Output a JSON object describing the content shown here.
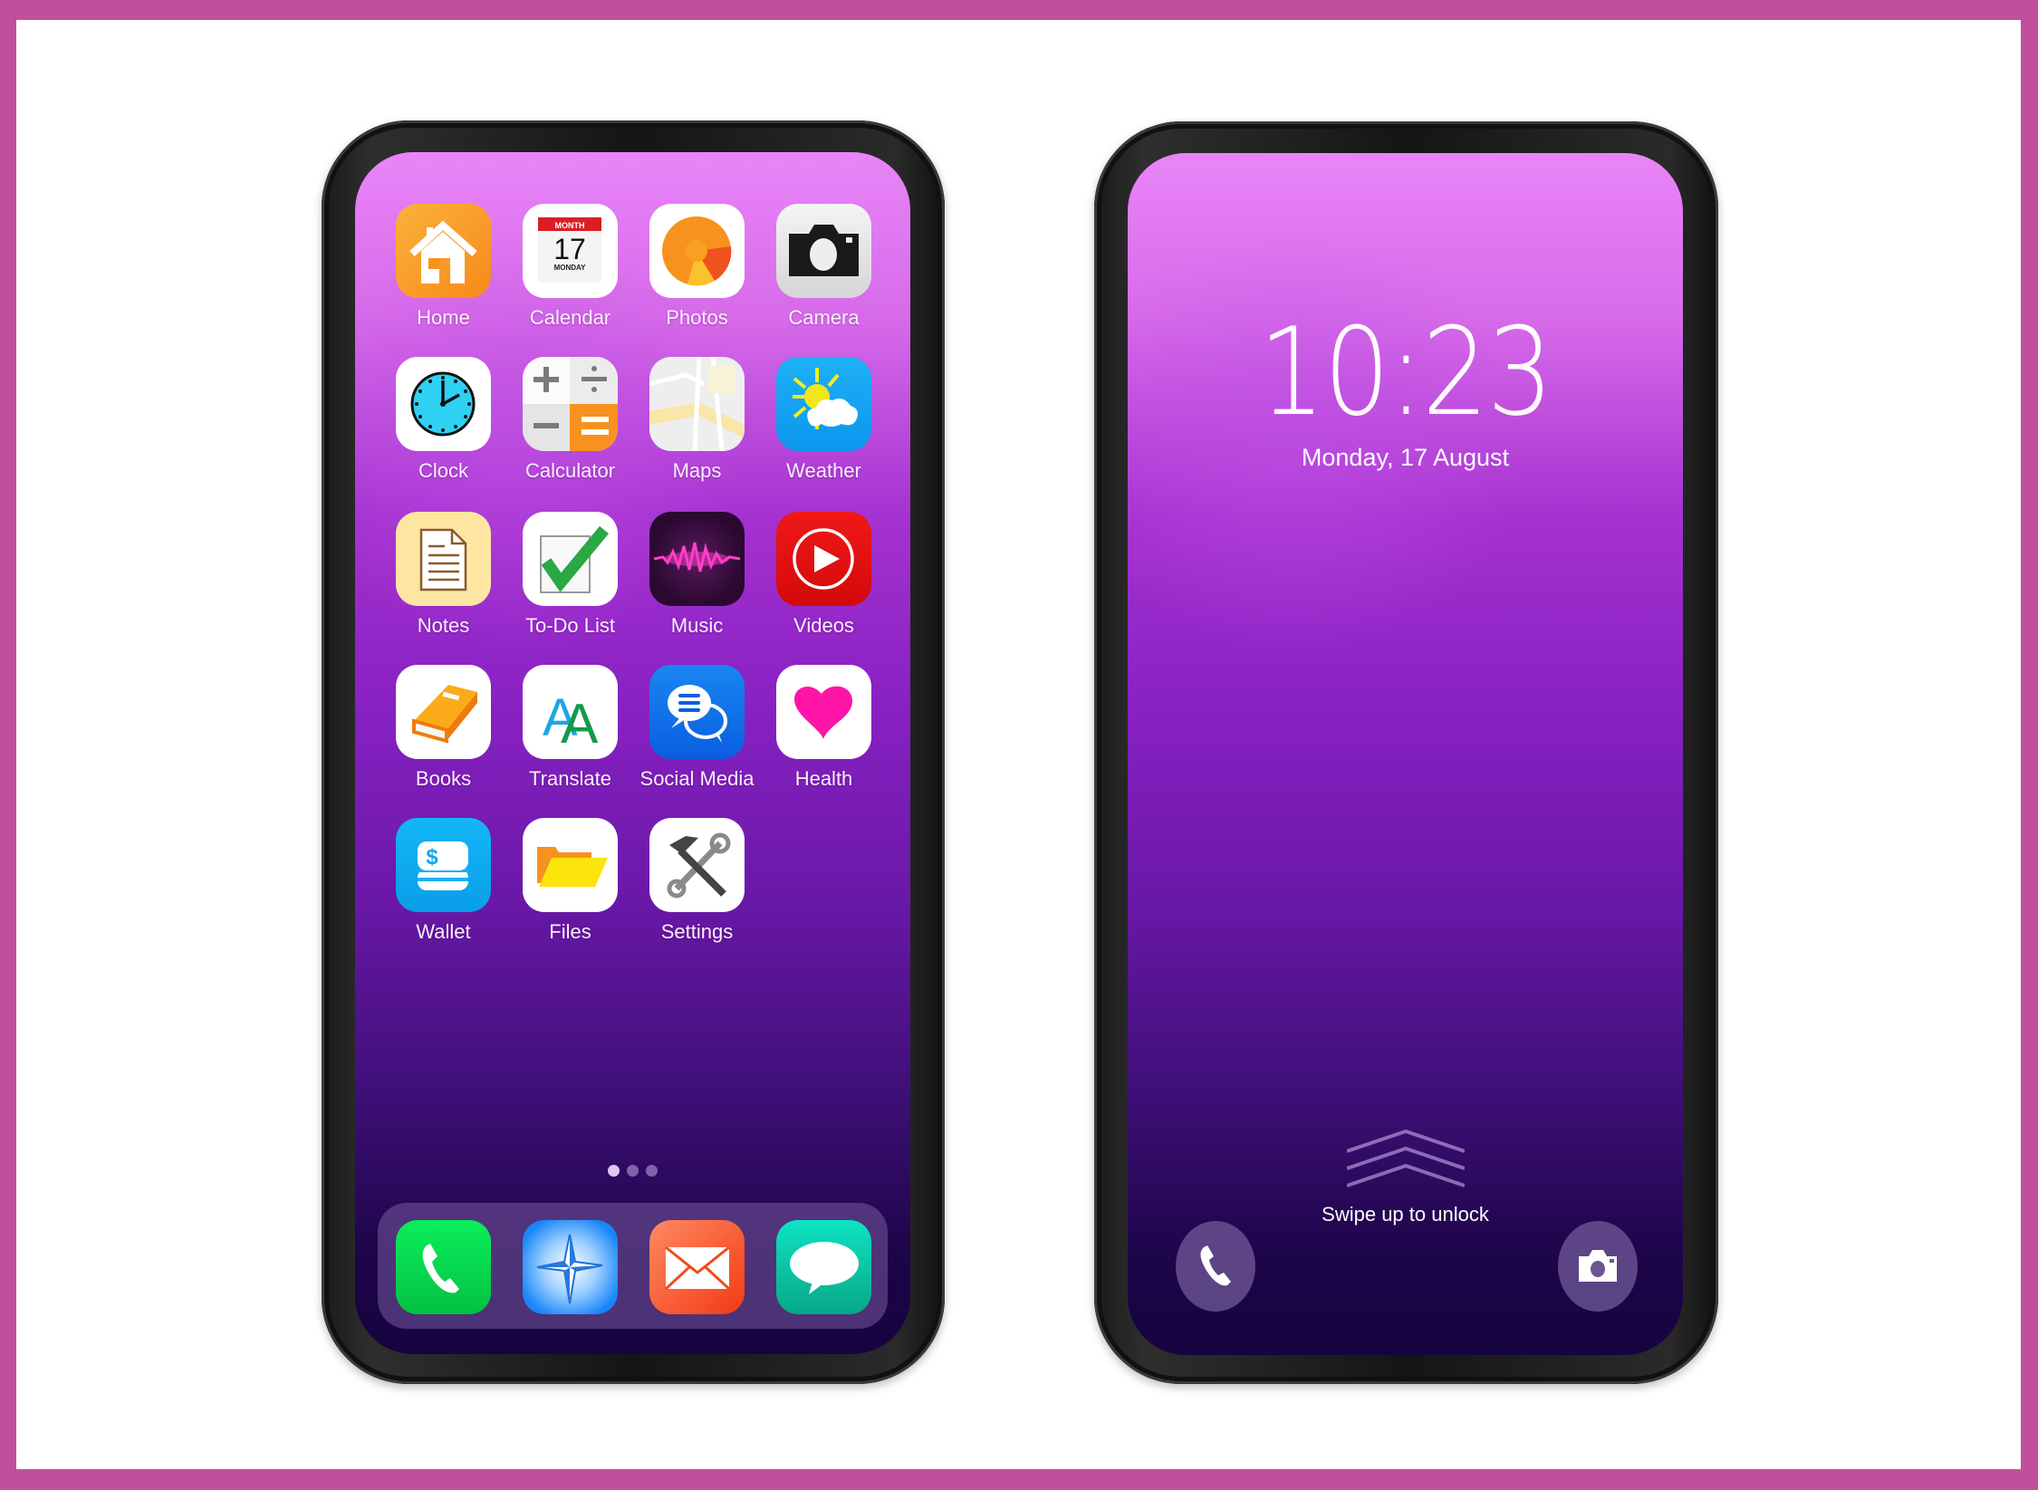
{
  "frame_color": "#c24f9c",
  "home_screen": {
    "apps": [
      {
        "label": "Home",
        "icon": "house-icon",
        "color": "#f7941d"
      },
      {
        "label": "Calendar",
        "icon": "calendar-icon",
        "month": "MONTH",
        "day": "17",
        "weekday": "MONDAY"
      },
      {
        "label": "Photos",
        "icon": "flower-icon"
      },
      {
        "label": "Camera",
        "icon": "camera-icon"
      },
      {
        "label": "Clock",
        "icon": "clock-icon"
      },
      {
        "label": "Calculator",
        "icon": "calculator-icon"
      },
      {
        "label": "Maps",
        "icon": "map-icon"
      },
      {
        "label": "Weather",
        "icon": "weather-icon"
      },
      {
        "label": "Notes",
        "icon": "notes-icon"
      },
      {
        "label": "To-Do List",
        "icon": "checkmark-icon"
      },
      {
        "label": "Music",
        "icon": "waveform-icon"
      },
      {
        "label": "Videos",
        "icon": "play-icon"
      },
      {
        "label": "Books",
        "icon": "book-icon"
      },
      {
        "label": "Translate",
        "icon": "translate-icon",
        "glyph": "AA"
      },
      {
        "label": "Social Media",
        "icon": "chat-bubbles-icon"
      },
      {
        "label": "Health",
        "icon": "heart-icon"
      },
      {
        "label": "Wallet",
        "icon": "wallet-icon",
        "glyph": "$"
      },
      {
        "label": "Files",
        "icon": "folder-icon"
      },
      {
        "label": "Settings",
        "icon": "tools-icon"
      }
    ],
    "page_indicator": {
      "pages": 3,
      "current": 1
    },
    "dock": [
      {
        "name": "Phone",
        "icon": "phone-icon"
      },
      {
        "name": "Browser",
        "icon": "compass-icon"
      },
      {
        "name": "Mail",
        "icon": "mail-icon"
      },
      {
        "name": "Messages",
        "icon": "message-icon"
      }
    ]
  },
  "lock_screen": {
    "time": "10:23",
    "date": "Monday, 17 August",
    "unlock_hint": "Swipe up to unlock",
    "shortcuts": [
      {
        "name": "Phone",
        "icon": "phone-icon"
      },
      {
        "name": "Camera",
        "icon": "camera-icon"
      }
    ]
  }
}
